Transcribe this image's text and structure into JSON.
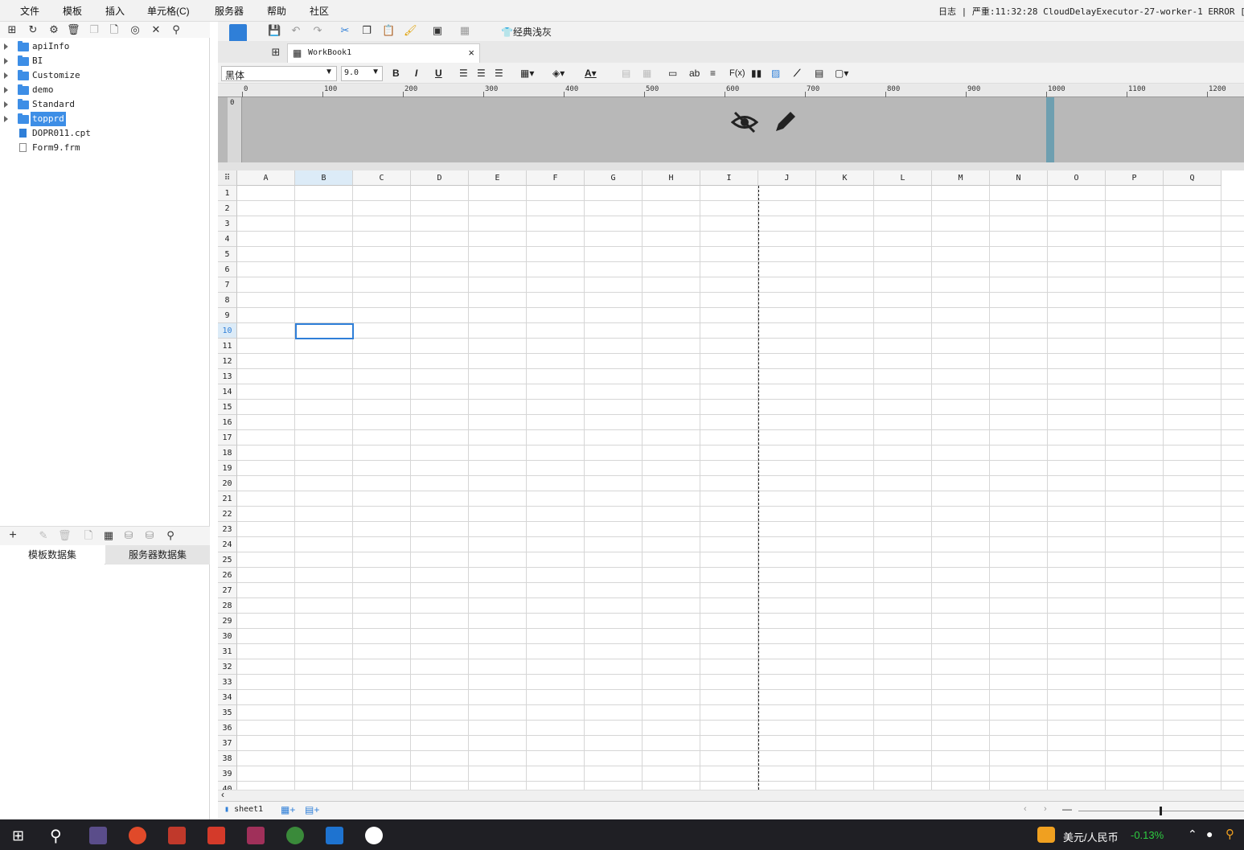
{
  "menu": {
    "items": [
      "文件",
      "模板",
      "插入",
      "单元格(C)",
      "服务器",
      "帮助",
      "社区"
    ]
  },
  "log": {
    "label": "日志",
    "message": "严重:11:32:28 CloudDelayExecutor-27-worker-1 ERROR [stan"
  },
  "tree": {
    "items": [
      {
        "label": "apiInfo",
        "type": "folder"
      },
      {
        "label": "BI",
        "type": "folder"
      },
      {
        "label": "Customize",
        "type": "folder"
      },
      {
        "label": "demo",
        "type": "folder"
      },
      {
        "label": "Standard",
        "type": "folder"
      },
      {
        "label": "topprd",
        "type": "folder",
        "selected": true
      },
      {
        "label": "DOPR011.cpt",
        "type": "cpt"
      },
      {
        "label": "Form9.frm",
        "type": "frm"
      }
    ]
  },
  "datasets": {
    "tab_template": "模板数据集",
    "tab_server": "服务器数据集"
  },
  "toolbar": {
    "theme_label": "经典浅灰"
  },
  "doc_tab": {
    "title": "WorkBook1",
    "close": "×"
  },
  "format": {
    "font_name": "黑体",
    "font_size": "9.0",
    "bold": "B",
    "italic": "I",
    "underline": "U",
    "fx": "F(x)",
    "ab": "ab"
  },
  "ruler": {
    "ticks": [
      "0",
      "100",
      "200",
      "300",
      "400",
      "500",
      "600",
      "700",
      "800",
      "900",
      "1000",
      "1100",
      "1200"
    ]
  },
  "grid": {
    "columns": [
      "A",
      "B",
      "C",
      "D",
      "E",
      "F",
      "G",
      "H",
      "I",
      "J",
      "K",
      "L",
      "M",
      "N",
      "O",
      "P",
      "Q"
    ],
    "selected_column": "B",
    "selected_row": 10,
    "rows": [
      "1",
      "2",
      "3",
      "4",
      "5",
      "6",
      "7",
      "8",
      "9",
      "10",
      "11",
      "12",
      "13",
      "14",
      "15",
      "16",
      "17",
      "18",
      "19",
      "20",
      "21",
      "22",
      "23",
      "24",
      "25",
      "26",
      "27",
      "28",
      "29",
      "30",
      "31",
      "32",
      "33",
      "34",
      "35",
      "36",
      "37",
      "38",
      "39",
      "40"
    ]
  },
  "sheets": {
    "tab": "sheet1"
  },
  "taskbar": {
    "currency": "美元/人民币",
    "change": "-0.13%",
    "change_color": "#2ecc40"
  },
  "colors": {
    "accent": "#2f7fd8",
    "band": "#b8b8b8"
  }
}
